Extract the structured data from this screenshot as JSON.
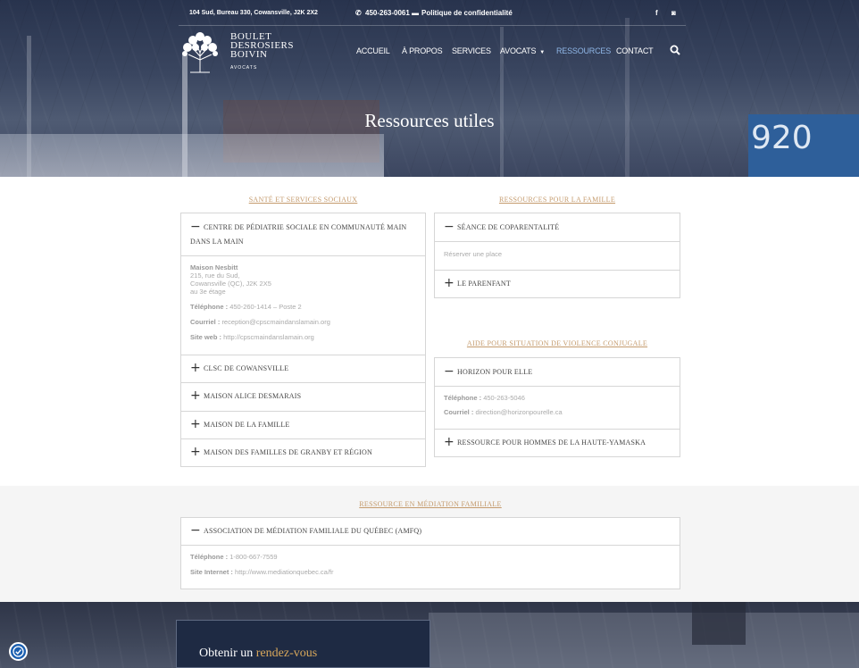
{
  "topbar": {
    "address": "104 Sud, Bureau 330, Cowansville, J2K 2X2",
    "phone": "450-263-0061",
    "privacy": "Politique de confidentialité",
    "social": [
      "f",
      "◙"
    ]
  },
  "logo": {
    "line1": "BOULET",
    "line2": "DESROSIERS",
    "line3": "BOIVIN",
    "sub": "AVOCATS"
  },
  "nav": {
    "items": [
      "ACCUEIL",
      "À PROPOS",
      "SERVICES",
      "AVOCATS",
      "RESSOURCES",
      "CONTACT"
    ],
    "active": "RESSOURCES"
  },
  "hero": {
    "title": "Ressources utiles",
    "sign": "920"
  },
  "sante": {
    "title": "SANTÉ ET SERVICES SOCIAUX",
    "open": {
      "label": "CENTRE DE PÉDIATRIE SOCIALE EN COMMUNAUTÉ MAIN DANS LA MAIN",
      "place": "Maison Nesbitt",
      "addr1": "215, rue du Sud,",
      "addr2": "Cowansville (QC), J2K 2X5",
      "addr3": "au 3e étage",
      "tel_label": "Téléphone :",
      "tel": "450-260-1414 – Poste 2",
      "mail_label": "Courriel :",
      "mail": "reception@cpscmaindanslamain.org",
      "web_label": "Site web :",
      "web": "http://cpscmaindanslamain.org"
    },
    "items": [
      "CLSC DE COWANSVILLE",
      "MAISON ALICE DESMARAIS",
      "MAISON DE LA FAMILLE",
      "MAISON DES FAMILLES DE GRANBY ET RÉGION"
    ]
  },
  "famille": {
    "title": "RESSOURCES POUR LA FAMILLE",
    "open": {
      "label": "SÉANCE DE COPARENTALITÉ",
      "text": "Réserver une place"
    },
    "items": [
      "LE PARENFANT"
    ]
  },
  "violence": {
    "title": "AIDE POUR SITUATION DE VIOLENCE CONJUGALE",
    "open": {
      "label": "HORIZON POUR ELLE",
      "tel_label": "Téléphone :",
      "tel": "450-263-5046",
      "mail_label": "Courriel :",
      "mail": "direction@horizonpourelle.ca"
    },
    "items": [
      "RESSOURCE POUR HOMMES DE LA HAUTE-YAMASKA"
    ]
  },
  "mediation": {
    "title": "RESSOURCE EN MÉDIATION FAMILIALE",
    "open": {
      "label": "ASSOCIATION DE MÉDIATION FAMILIALE DU QUÉBEC (AMFQ)",
      "tel_label": "Téléphone :",
      "tel": "1-800-667-7559",
      "web_label": "Site Internet :",
      "web": "http://www.mediationquebec.ca/fr"
    }
  },
  "cta": {
    "part1": "Obtenir un",
    "part2": "rendez-vous"
  }
}
